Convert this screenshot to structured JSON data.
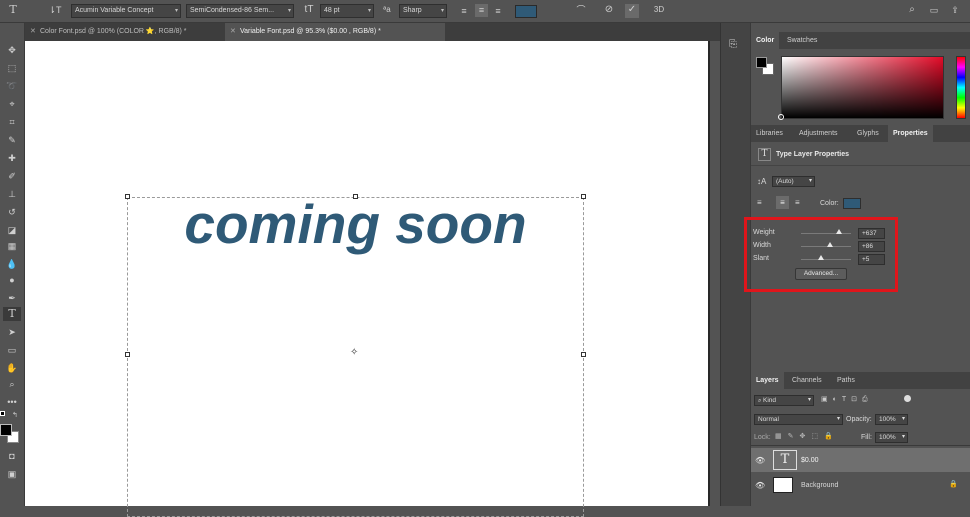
{
  "options_bar": {
    "tool_icon": "type-tool-icon",
    "font_family": "Acumin Variable Concept",
    "font_style": "SemiCondensed-86 Sem...",
    "font_size": "48 pt",
    "aa_label": "ªa",
    "anti_alias": "Sharp",
    "text_color": "#2f5a77",
    "three_d": "3D"
  },
  "tabs": [
    {
      "label": "Color Font.psd @ 100% (COLOR  ⭐, RGB/8) *",
      "active": false
    },
    {
      "label": "Variable Font.psd @ 95.3% ($0.00   , RGB/8) *",
      "active": true
    }
  ],
  "canvas": {
    "text": "coming soon",
    "text_color": "#2f5a77"
  },
  "color_panel": {
    "tabs": [
      "Color",
      "Swatches"
    ],
    "foreground": "#000000",
    "background": "#ffffff"
  },
  "properties_panel": {
    "tabs": [
      "Libraries",
      "Adjustments",
      "Glyphs",
      "Properties"
    ],
    "title": "Type Layer Properties",
    "leading": "(Auto)",
    "color_label": "Color:",
    "color": "#2f5a77",
    "sliders": [
      {
        "label": "Weight",
        "value": "+637",
        "level": 0.75
      },
      {
        "label": "Width",
        "value": "+86",
        "level": 0.58
      },
      {
        "label": "Slant",
        "value": "+5",
        "level": 0.4
      }
    ],
    "advanced_button": "Advanced...",
    "highlight_color": "#e0151b"
  },
  "layers_panel": {
    "tabs": [
      "Layers",
      "Channels",
      "Paths"
    ],
    "kind_label": "Kind",
    "blend_mode": "Normal",
    "opacity_label": "Opacity:",
    "opacity": "100%",
    "lock_label": "Lock:",
    "fill_label": "Fill:",
    "fill": "100%",
    "layers": [
      {
        "name": "$0.00",
        "type": "text",
        "selected": true
      },
      {
        "name": "Background",
        "type": "image",
        "selected": false
      }
    ]
  }
}
